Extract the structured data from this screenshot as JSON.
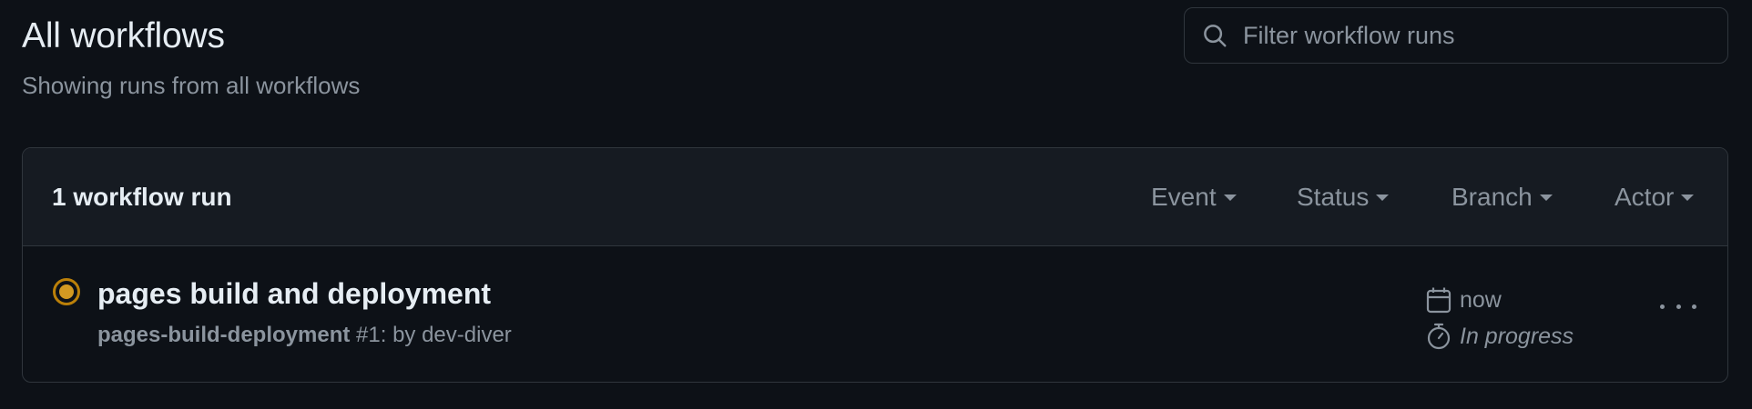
{
  "header": {
    "title": "All workflows",
    "subtitle": "Showing runs from all workflows"
  },
  "search": {
    "placeholder": "Filter workflow runs",
    "value": "",
    "icon": "search-icon"
  },
  "runs_box": {
    "count_label": "1 workflow run",
    "filters": [
      {
        "label": "Event"
      },
      {
        "label": "Status"
      },
      {
        "label": "Branch"
      },
      {
        "label": "Actor"
      }
    ],
    "runs": [
      {
        "status": "in_progress",
        "status_icon": "in-progress-icon",
        "status_color": "#d29922",
        "name": "pages build and deployment",
        "workflow": "pages-build-deployment",
        "meta": "#1: by dev-diver",
        "time": "now",
        "time_icon": "calendar-icon",
        "duration": "In progress",
        "duration_icon": "stopwatch-icon",
        "menu_icon": "kebab-horizontal-icon"
      }
    ]
  },
  "colors": {
    "background": "#0d1117",
    "header_bg": "#161b22",
    "border": "#30363d",
    "text_primary": "#e6edf3",
    "text_muted": "#8b949e"
  }
}
